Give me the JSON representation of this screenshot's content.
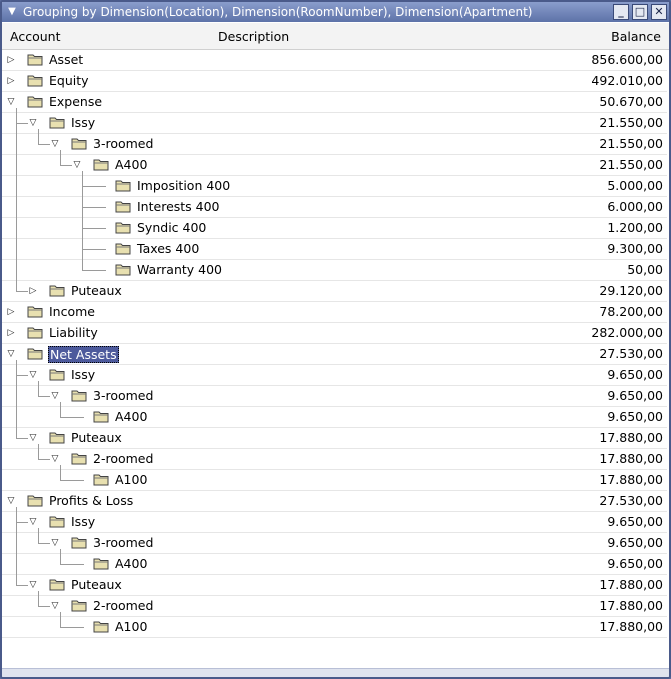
{
  "window": {
    "title": "Grouping by Dimension(Location), Dimension(RoomNumber), Dimension(Apartment)"
  },
  "columns": {
    "account": "Account",
    "description": "Description",
    "balance": "Balance"
  },
  "rows": [
    {
      "label": "Asset",
      "balance": "856.600,00",
      "level": 0,
      "state": "collapsed"
    },
    {
      "label": "Equity",
      "balance": "492.010,00",
      "level": 0,
      "state": "collapsed"
    },
    {
      "label": "Expense",
      "balance": "50.670,00",
      "level": 0,
      "state": "expanded"
    },
    {
      "label": "Issy",
      "balance": "21.550,00",
      "level": 1,
      "state": "expanded"
    },
    {
      "label": "3-roomed",
      "balance": "21.550,00",
      "level": 2,
      "state": "expanded"
    },
    {
      "label": "A400",
      "balance": "21.550,00",
      "level": 3,
      "state": "expanded"
    },
    {
      "label": "Imposition 400",
      "balance": "5.000,00",
      "level": 4,
      "state": "leaf"
    },
    {
      "label": "Interests 400",
      "balance": "6.000,00",
      "level": 4,
      "state": "leaf"
    },
    {
      "label": "Syndic 400",
      "balance": "1.200,00",
      "level": 4,
      "state": "leaf"
    },
    {
      "label": "Taxes 400",
      "balance": "9.300,00",
      "level": 4,
      "state": "leaf"
    },
    {
      "label": "Warranty 400",
      "balance": "50,00",
      "level": 4,
      "state": "leaf"
    },
    {
      "label": "Puteaux",
      "balance": "29.120,00",
      "level": 1,
      "state": "collapsed"
    },
    {
      "label": "Income",
      "balance": "78.200,00",
      "level": 0,
      "state": "collapsed"
    },
    {
      "label": "Liability",
      "balance": "282.000,00",
      "level": 0,
      "state": "collapsed"
    },
    {
      "label": "Net Assets",
      "balance": "27.530,00",
      "level": 0,
      "state": "expanded",
      "selected": true
    },
    {
      "label": "Issy",
      "balance": "9.650,00",
      "level": 1,
      "state": "expanded"
    },
    {
      "label": "3-roomed",
      "balance": "9.650,00",
      "level": 2,
      "state": "expanded"
    },
    {
      "label": "A400",
      "balance": "9.650,00",
      "level": 3,
      "state": "leaf"
    },
    {
      "label": "Puteaux",
      "balance": "17.880,00",
      "level": 1,
      "state": "expanded"
    },
    {
      "label": "2-roomed",
      "balance": "17.880,00",
      "level": 2,
      "state": "expanded"
    },
    {
      "label": "A100",
      "balance": "17.880,00",
      "level": 3,
      "state": "leaf"
    },
    {
      "label": "Profits & Loss",
      "balance": "27.530,00",
      "level": 0,
      "state": "expanded"
    },
    {
      "label": "Issy",
      "balance": "9.650,00",
      "level": 1,
      "state": "expanded"
    },
    {
      "label": "3-roomed",
      "balance": "9.650,00",
      "level": 2,
      "state": "expanded"
    },
    {
      "label": "A400",
      "balance": "9.650,00",
      "level": 3,
      "state": "leaf"
    },
    {
      "label": "Puteaux",
      "balance": "17.880,00",
      "level": 1,
      "state": "expanded"
    },
    {
      "label": "2-roomed",
      "balance": "17.880,00",
      "level": 2,
      "state": "expanded"
    },
    {
      "label": "A100",
      "balance": "17.880,00",
      "level": 3,
      "state": "leaf"
    }
  ],
  "icons": {
    "folder": "folder-icon",
    "expanded": "triangle-down-icon",
    "collapsed": "triangle-right-icon"
  },
  "colors": {
    "title_bar": "#5d72a8",
    "selection": "#4d5a9c",
    "folder": "#e8e0b0"
  }
}
